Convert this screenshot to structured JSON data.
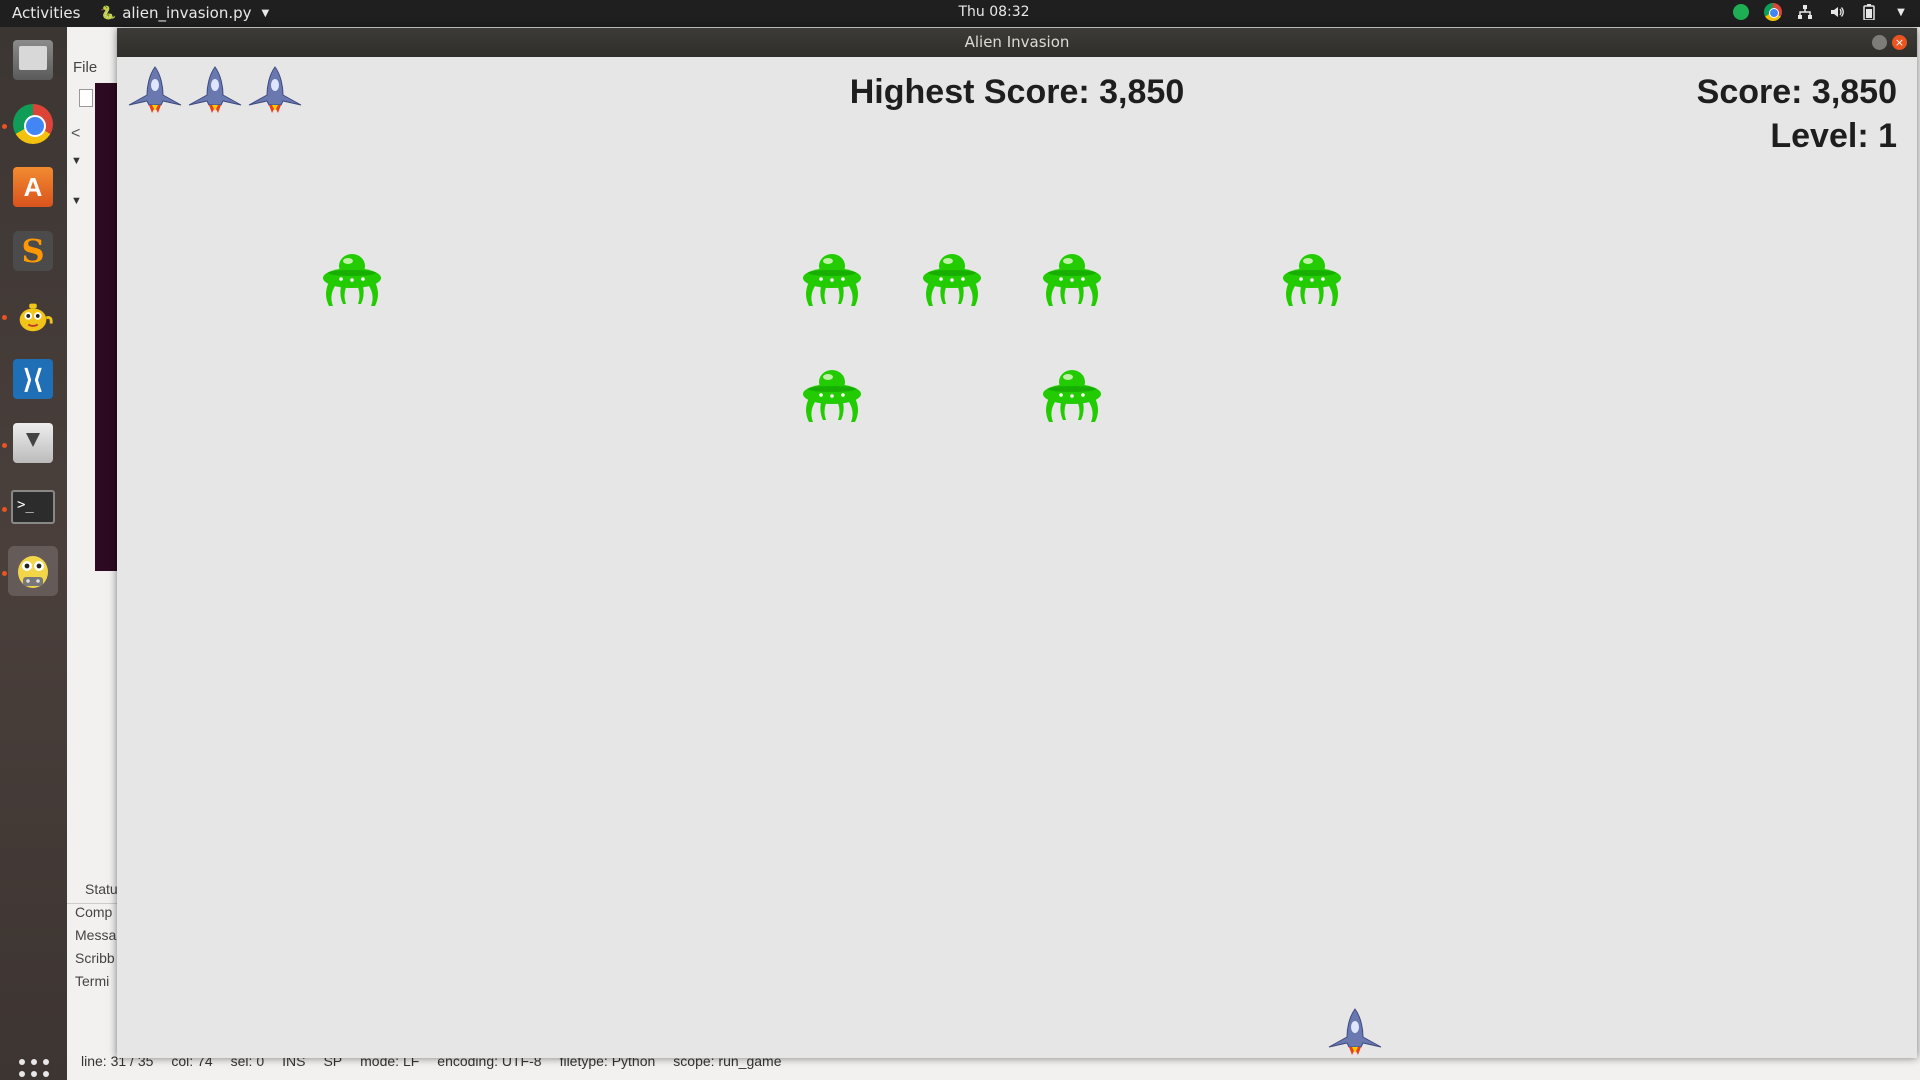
{
  "topbar": {
    "activities": "Activities",
    "app_name": "alien_invasion.py",
    "clock": "Thu 08:32"
  },
  "dock": {
    "items": [
      "files-icon",
      "chrome-icon",
      "software-store-icon",
      "sublime-text-icon",
      "teapot-icon",
      "vscode-icon",
      "installer-icon",
      "terminal-icon",
      "pygame-icon"
    ],
    "active": "pygame-icon"
  },
  "editor": {
    "menu_file": "File",
    "status_tabs": [
      "Statu",
      "Comp",
      "Messa",
      "Scribb",
      "Termi"
    ],
    "statusbar": {
      "line": "line: 31 / 35",
      "col": "col: 74",
      "sel": "sel: 0",
      "ins": "INS",
      "sp": "SP",
      "mode": "mode: LF",
      "encoding": "encoding: UTF-8",
      "filetype": "filetype: Python",
      "scope": "scope: run_game"
    }
  },
  "game": {
    "window_title": "Alien Invasion",
    "highest_score": "Highest Score: 3,850",
    "score": "Score: 3,850",
    "level": "Level: 1",
    "lives_remaining": 3,
    "alien_color": "#22cc00",
    "ship_color": "#6a78b0",
    "background_color": "#e6e6e6",
    "alien_count": 7
  }
}
